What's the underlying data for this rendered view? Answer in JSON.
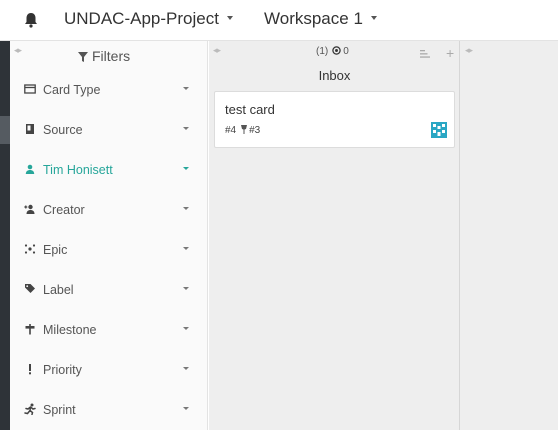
{
  "topbar": {
    "project_name": "UNDAC-App-Project",
    "workspace_name": "Workspace 1"
  },
  "sidebar": {
    "header": "Filters",
    "filters": [
      {
        "label": "Card Type",
        "icon": "card-type-icon",
        "active": false
      },
      {
        "label": "Source",
        "icon": "source-icon",
        "active": false
      },
      {
        "label": "Tim Honisett",
        "icon": "person-icon",
        "active": true
      },
      {
        "label": "Creator",
        "icon": "creator-icon",
        "active": false
      },
      {
        "label": "Epic",
        "icon": "epic-icon",
        "active": false
      },
      {
        "label": "Label",
        "icon": "label-icon",
        "active": false
      },
      {
        "label": "Milestone",
        "icon": "milestone-icon",
        "active": false
      },
      {
        "label": "Priority",
        "icon": "priority-icon",
        "active": false
      },
      {
        "label": "Sprint",
        "icon": "sprint-icon",
        "active": false
      }
    ]
  },
  "column": {
    "count": "(1)",
    "estimate": "0",
    "title": "Inbox"
  },
  "card": {
    "title": "test card",
    "number": "#4",
    "ref": "#3"
  },
  "colors": {
    "accent": "#26a69a",
    "sidebar_dark": "#2e3338",
    "board_bg": "#eeeeee"
  }
}
